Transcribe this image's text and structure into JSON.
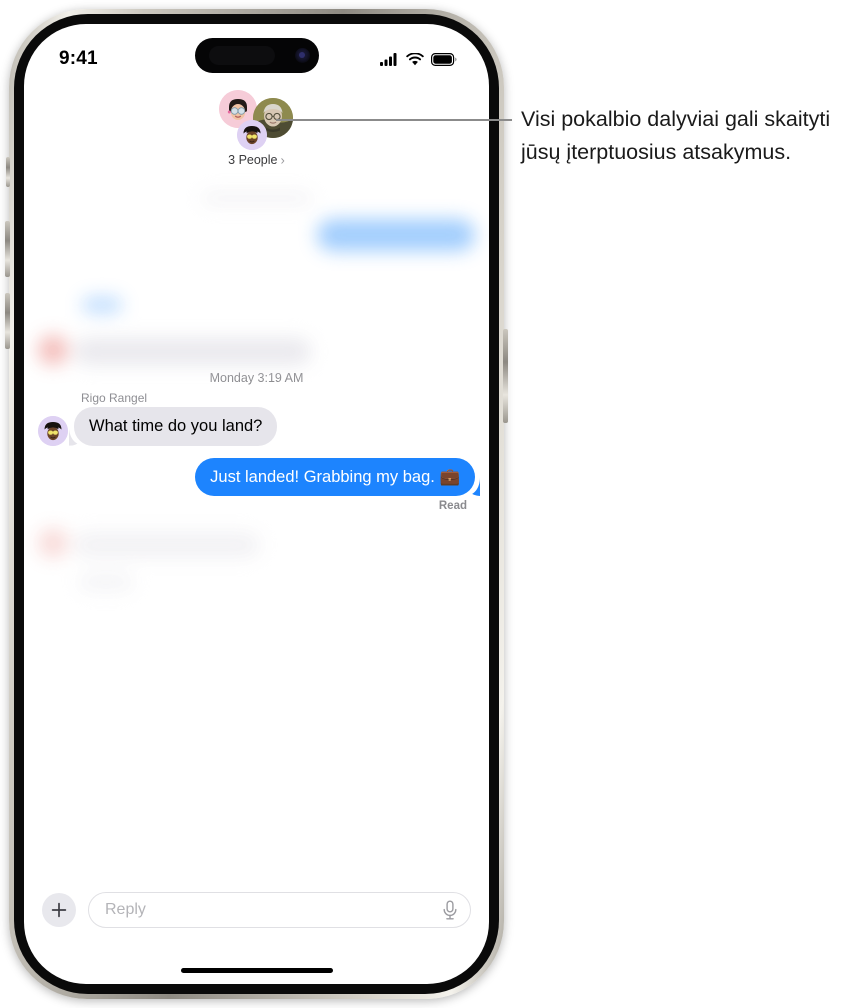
{
  "device": {
    "status_bar": {
      "time": "9:41",
      "cellular_icon": "signal-bars-icon",
      "wifi_icon": "wifi-icon",
      "battery_icon": "battery-full-icon"
    },
    "dynamic_island": "dynamic-island",
    "home_indicator": "home-indicator",
    "buttons": [
      "mute-switch",
      "volume-up-button",
      "volume-down-button",
      "power-button"
    ]
  },
  "chat_header": {
    "group_label": "3 People",
    "chevron": "›",
    "avatars": [
      {
        "name": "memoji-avatar-pink",
        "background": "#f6ccd8"
      },
      {
        "name": "photo-avatar-olive",
        "background": "#7f7a48"
      },
      {
        "name": "memoji-avatar-purple",
        "background": "#ded1f3"
      }
    ]
  },
  "conversation": {
    "timestamp": "Monday 3:19 AM",
    "messages": [
      {
        "id": "received-1",
        "direction": "incoming",
        "sender": "Rigo Rangel",
        "text": "What time do you land?",
        "avatar": "memoji-avatar-purple"
      },
      {
        "id": "sent-1",
        "direction": "outgoing",
        "text": "Just landed! Grabbing my bag. 💼",
        "status": "Read"
      }
    ]
  },
  "input_bar": {
    "add_button_label": "+",
    "placeholder": "Reply",
    "mic_icon": "microphone-icon"
  },
  "callout": {
    "text": "Visi pokalbio dalyviai gali skaityti jūsų įterptuosius atsakymus."
  },
  "colors": {
    "imessage_blue": "#1d84fe",
    "bubble_gray": "#e6e5eb",
    "secondary_text": "#8e8e93"
  }
}
